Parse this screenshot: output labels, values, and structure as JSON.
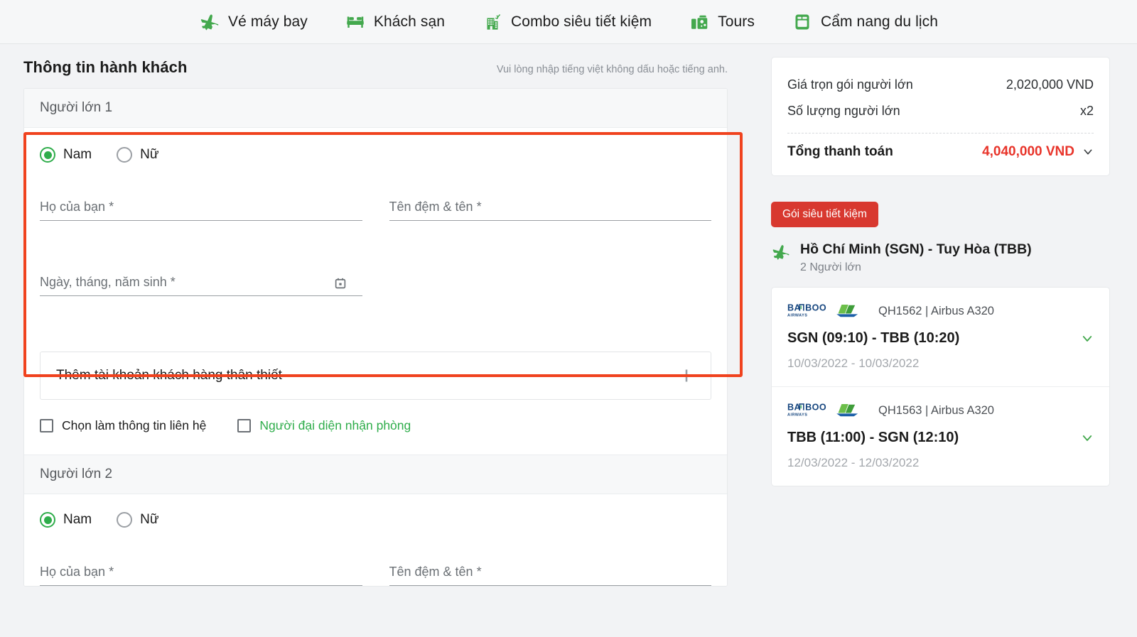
{
  "nav": {
    "items": [
      {
        "label": "Vé máy bay",
        "icon": "airplane-icon"
      },
      {
        "label": "Khách sạn",
        "icon": "hotel-bed-icon"
      },
      {
        "label": "Combo siêu tiết kiệm",
        "icon": "combo-building-plane-icon"
      },
      {
        "label": "Tours",
        "icon": "suitcase-icon"
      },
      {
        "label": "Cẩm nang du lịch",
        "icon": "guidebook-icon"
      }
    ]
  },
  "section": {
    "title": "Thông tin hành khách",
    "hint": "Vui lòng nhập tiếng việt không dấu hoặc tiếng anh."
  },
  "passengers": [
    {
      "header": "Người lớn 1",
      "gender": {
        "male_label": "Nam",
        "female_label": "Nữ",
        "selected": "Nam"
      },
      "fields": {
        "last_name_placeholder": "Họ của bạn *",
        "last_name_value": "",
        "first_name_placeholder": "Tên đệm & tên *",
        "first_name_value": "",
        "dob_placeholder": "Ngày, tháng, năm sinh *",
        "dob_value": "",
        "calendar_icon": "calendar-icon"
      },
      "loyalty": {
        "label": "Thêm tài khoản khách hàng thân thiết",
        "add_icon": "plus-icon"
      },
      "checkboxes": [
        {
          "label": "Chọn làm thông tin liên hệ",
          "checked": false,
          "accent": "default"
        },
        {
          "label": "Người đại diện nhận phòng",
          "checked": false,
          "accent": "green"
        }
      ]
    },
    {
      "header": "Người lớn 2",
      "gender": {
        "male_label": "Nam",
        "female_label": "Nữ",
        "selected": "Nam"
      },
      "fields": {
        "last_name_placeholder": "Họ của bạn *",
        "last_name_value": "",
        "first_name_placeholder": "Tên đệm & tên *",
        "first_name_value": ""
      }
    }
  ],
  "summary": {
    "rows": [
      {
        "label": "Giá trọn gói người lớn",
        "value": "2,020,000 VND"
      },
      {
        "label": "Số lượng người lớn",
        "value": "x2"
      }
    ],
    "total_label": "Tổng thanh toán",
    "total_value": "4,040,000 VND",
    "expand_icon": "chevron-down-icon"
  },
  "booking": {
    "tag": "Gói siêu tiết kiệm",
    "route_icon": "airplane-icon",
    "route_title": "Hồ Chí Minh (SGN) - Tuy Hòa (TBB)",
    "route_sub": "2 Người lớn"
  },
  "flights": [
    {
      "airline_logo": "bamboo-airways-logo",
      "code": "QH1562 | Airbus A320",
      "route": "SGN (09:10) - TBB (10:20)",
      "dates": "10/03/2022 - 10/03/2022",
      "expand_icon": "chevron-down-icon"
    },
    {
      "airline_logo": "bamboo-airways-logo",
      "code": "QH1563 | Airbus A320",
      "route": "TBB (11:00) - SGN (12:10)",
      "dates": "12/03/2022 - 12/03/2022",
      "expand_icon": "chevron-down-icon"
    }
  ],
  "colors": {
    "brand_green": "#2fad4b",
    "accent_red": "#e8342a",
    "tag_red": "#d8382f",
    "highlight_outline": "#f0421e",
    "page_bg": "#f2f3f5"
  }
}
